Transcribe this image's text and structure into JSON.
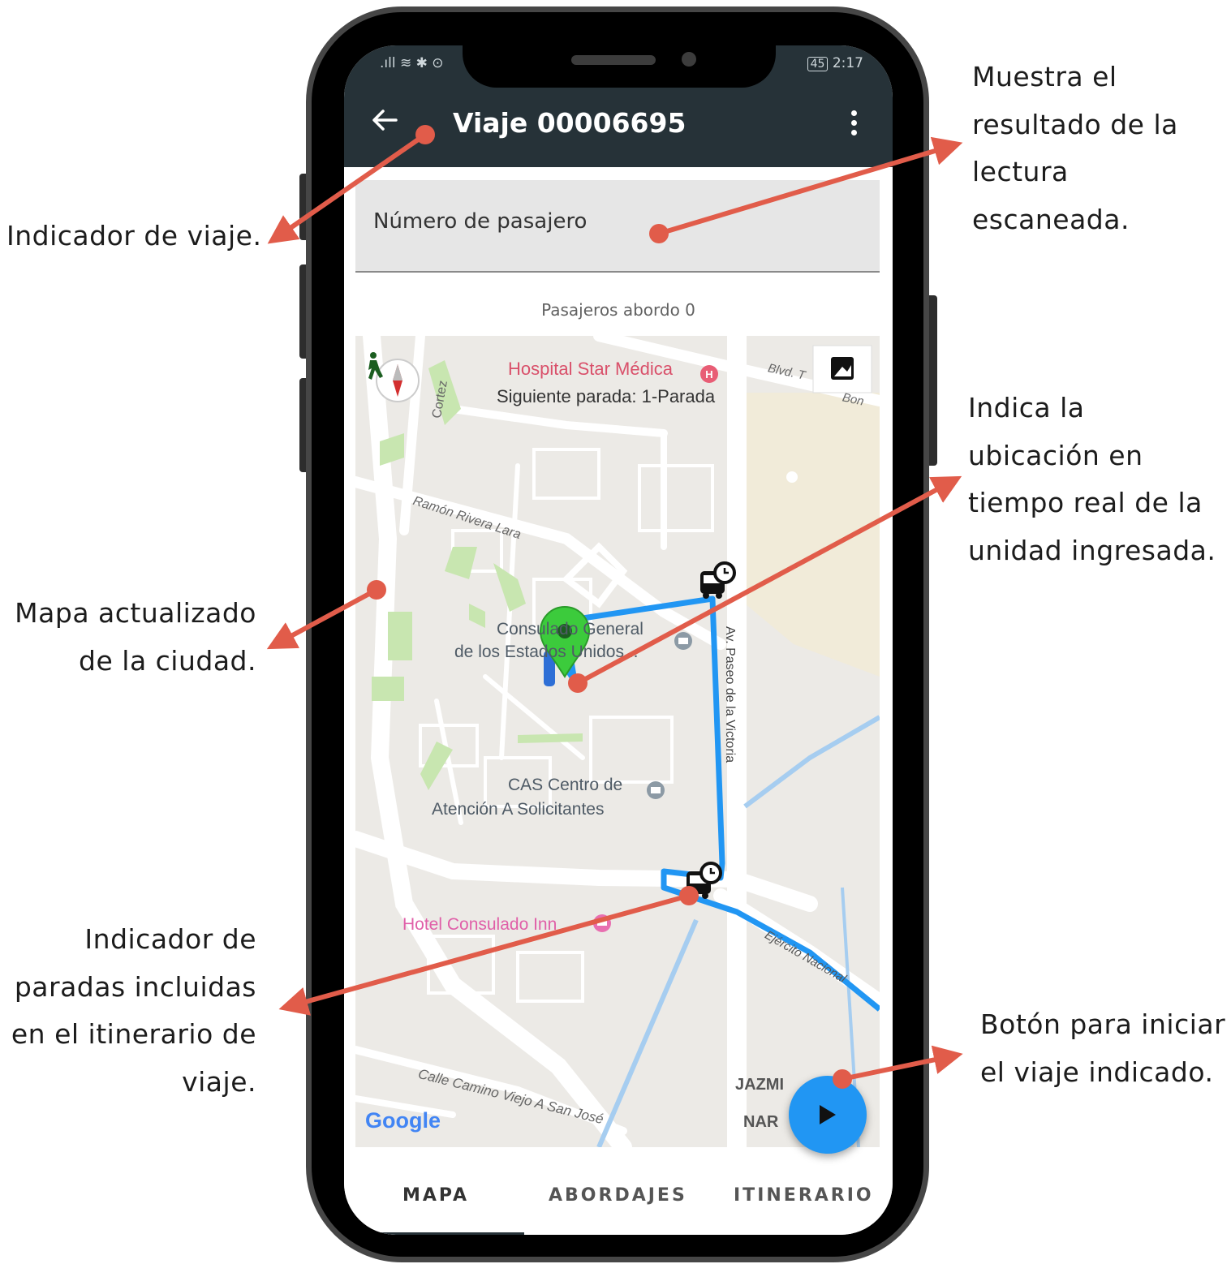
{
  "annotations": {
    "muestra": "Muestra el\nresultado de la\nlectura\nescaneada.",
    "indicador_viaje": "Indicador de viaje.",
    "ubicacion": "Indica la\nubicación en\ntiempo real de la\nunidad ingresada.",
    "mapa": "Mapa actualizado\nde la ciudad.",
    "paradas": "Indicador de\nparadas incluidas\nen el itinerario de\nviaje.",
    "boton": "Botón para iniciar\nel viaje indicado."
  },
  "status_bar": {
    "left": ".ıll ≋ ✱ ⊙",
    "battery": "45",
    "time": "2:17"
  },
  "header": {
    "title": "Viaje 00006695",
    "back_icon": "arrow-left-icon",
    "menu_icon": "more-vertical-icon"
  },
  "input": {
    "placeholder": "Número de pasajero"
  },
  "passengers_text": "Pasajeros abordo 0",
  "map": {
    "hospital": "Hospital Star Médica",
    "next_stop": "Siguiente parada: 1-Parada",
    "blvd": "Blvd. T",
    "blvd2": "Bon",
    "cortez": "Cortez",
    "ramon": "Ramón Rivera Lara",
    "consulado_1": "Consulado General",
    "consulado_2": "de los Estados Unidos...",
    "av_paseo": "Av. Paseo de la Victoria",
    "cas_1": "CAS Centro de",
    "cas_2": "Atención A Solicitantes",
    "hotel": "Hotel Consulado Inn",
    "ejercito": "Ejército Nacional",
    "calle_camino": "Calle Camino Viejo A San José",
    "jazmi": "JAZMI",
    "nar": "NAR",
    "google": "Google",
    "route_color": "#2196f3",
    "pin_color": "#34c934"
  },
  "tabs": {
    "mapa": "MAPA",
    "abordajes": "ABORDAJES",
    "itinerario": "ITINERARIO"
  },
  "arrow_color": "#e15c4a"
}
